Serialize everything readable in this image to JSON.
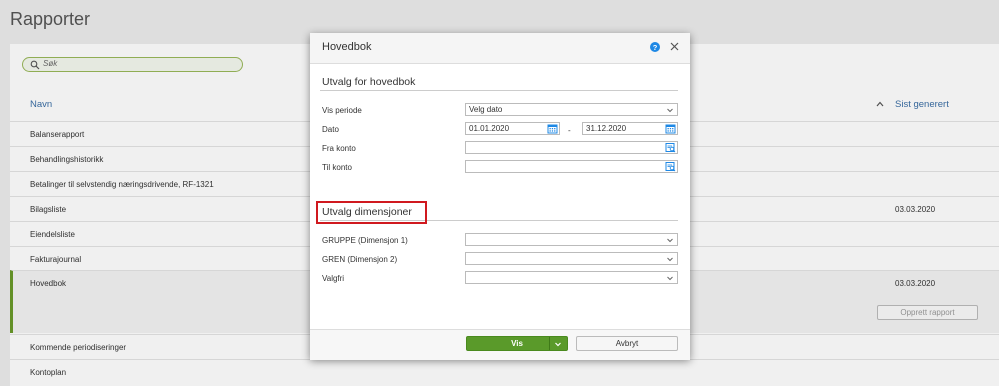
{
  "page": {
    "title": "Rapporter"
  },
  "search": {
    "placeholder": "Søk"
  },
  "table": {
    "col_name": "Navn",
    "col_generated": "Sist generert",
    "rows": [
      {
        "name": "Balanserapport",
        "date": ""
      },
      {
        "name": "Behandlingshistorikk",
        "date": ""
      },
      {
        "name": "Betalinger til selvstendig næringsdrivende, RF-1321",
        "date": ""
      },
      {
        "name": "Bilagsliste",
        "date": "03.03.2020"
      },
      {
        "name": "Eiendelsliste",
        "date": ""
      },
      {
        "name": "Fakturajournal",
        "date": ""
      },
      {
        "name": "Hovedbok",
        "date": "03.03.2020"
      },
      {
        "name": "Kommende periodiseringer",
        "date": ""
      },
      {
        "name": "Kontoplan",
        "date": ""
      }
    ],
    "create_report_label": "Opprett rapport"
  },
  "modal": {
    "title": "Hovedbok",
    "section1_title": "Utvalg for hovedbok",
    "vis_periode_label": "Vis periode",
    "vis_periode_value": "Velg dato",
    "dato_label": "Dato",
    "dato_from": "01.01.2020",
    "dato_to": "31.12.2020",
    "dash": "-",
    "fra_konto_label": "Fra konto",
    "til_konto_label": "Til konto",
    "section2_title": "Utvalg dimensjoner",
    "gruppe_label": "GRUPPE (Dimensjon 1)",
    "gren_label": "GREN (Dimensjon 2)",
    "valgfri_label": "Valgfri",
    "vis_button": "Vis",
    "avbryt_button": "Avbryt"
  },
  "colors": {
    "accent_green": "#5a9a2a",
    "link_blue": "#3a6ea5",
    "highlight_red": "#d0191f",
    "help_blue": "#1e88e5"
  }
}
